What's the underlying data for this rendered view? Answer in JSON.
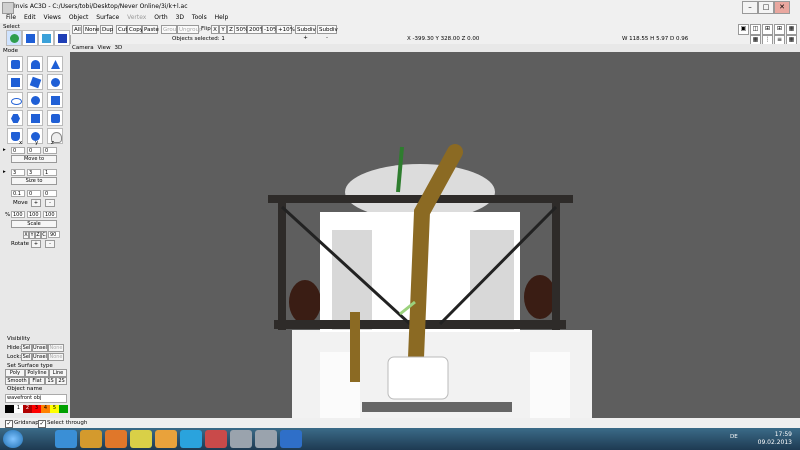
{
  "window": {
    "title": "Invis AC3D - C:/Users/tobi/Desktop/Never Online/3i/k+l.ac",
    "minimize": "–",
    "maximize": "□",
    "close": "✕"
  },
  "menu": [
    "File",
    "Edit",
    "Views",
    "Object",
    "Surface",
    "Vertex",
    "Orth",
    "3D",
    "Tools",
    "Help"
  ],
  "select_panel": {
    "label": "Select",
    "mode_label": "Mode"
  },
  "toolbar": {
    "buttons": [
      "All",
      "None",
      "Dup",
      "Cut",
      "Copy",
      "Paste",
      "Group",
      "Ungroup"
    ],
    "flip_label": "Flip:",
    "flip_axes": [
      "X",
      "Y",
      "Z"
    ],
    "zoom_buttons": [
      "50%",
      "200%",
      "-10%",
      "+10%"
    ],
    "subdiv_buttons": [
      "Subdiv +",
      "Subdiv -"
    ],
    "disabled": [
      "Group",
      "Ungroup"
    ]
  },
  "status": {
    "objects_selected": "Objects selected: 1",
    "coordinates": "X -399.30 Y 328.00 Z 0.00",
    "dimensions": "W 118.55 H 5.97 D 0.96"
  },
  "transform": {
    "axis_headers": [
      "x",
      "y",
      "z"
    ],
    "move_to_values": [
      "0",
      "0",
      "0"
    ],
    "move_to_label": "Move to",
    "size_to_values": [
      "3",
      "3",
      "1"
    ],
    "size_to_label": "Size to",
    "move_values": [
      "0.1",
      "0",
      "0"
    ],
    "move_label": "Move",
    "scale_values": [
      "100",
      "100",
      "100"
    ],
    "scale_unit": "%",
    "scale_label": "Scale",
    "rotate_axes": [
      "X",
      "Y",
      "Z",
      "C"
    ],
    "rotate_value": "90",
    "rotate_label": "Rotate",
    "plus": "+",
    "minus": "-"
  },
  "visibility": {
    "label": "Visibility",
    "hide_label": "Hide:",
    "lock_label": "Lock:",
    "sel": "Sel",
    "unsel": "Unsel",
    "none": "None"
  },
  "surface_type": {
    "label": "Set Surface type",
    "poly": "Poly",
    "polyline": "Polyline",
    "line": "Line",
    "smooth": "Smooth",
    "flat": "Flat",
    "one_s": "1S",
    "two_s": "2S"
  },
  "object_name": {
    "label": "Object name",
    "value": "wavefront obj"
  },
  "palette": {
    "labels": [
      "1",
      "2",
      "3",
      "4",
      "5"
    ],
    "colors": [
      "#000000",
      "#ffffff",
      "#b00000",
      "#ff0000",
      "#ff8000",
      "#ffff00",
      "#00a000"
    ]
  },
  "viewport": {
    "header": [
      "Camera",
      "View",
      "3D"
    ],
    "background": "#5e5e5e"
  },
  "bottom_options": {
    "gridsnap": "Gridsnap",
    "select_through": "Select through"
  },
  "taskbar": {
    "time": "17:59",
    "date": "09.02.2013",
    "language": "DE",
    "items": [
      "start-orb",
      "ie-icon",
      "media-icon",
      "firefox-icon",
      "chrome-icon",
      "app-icon",
      "skype-icon",
      "paint-icon",
      "ac3d-icon",
      "ac3d-icon-2",
      "app-icon-2"
    ]
  }
}
